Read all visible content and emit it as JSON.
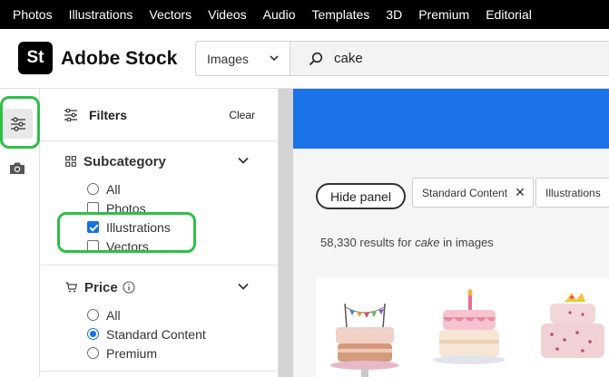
{
  "topnav": {
    "items": [
      "Photos",
      "Illustrations",
      "Vectors",
      "Videos",
      "Audio",
      "Templates",
      "3D",
      "Premium",
      "Editorial"
    ]
  },
  "header": {
    "logo_text": "St",
    "brand": "Adobe Stock",
    "type_select": "Images",
    "search_value": "cake"
  },
  "filters": {
    "title": "Filters",
    "clear": "Clear",
    "subcategory": {
      "title": "Subcategory",
      "options": [
        "All",
        "Photos",
        "Illustrations",
        "Vectors"
      ],
      "selected": "Illustrations"
    },
    "price": {
      "title": "Price",
      "options": [
        "All",
        "Standard Content",
        "Premium"
      ],
      "selected": "Standard Content"
    }
  },
  "main": {
    "hide_panel": "Hide panel",
    "chips": [
      "Standard Content",
      "Illustrations"
    ],
    "results_count": "58,330 results for",
    "results_query": "cake",
    "results_suffix": "in images"
  },
  "colors": {
    "accent": "#1473e6",
    "banner": "#1a73e8",
    "annotation": "#2fbf48"
  }
}
